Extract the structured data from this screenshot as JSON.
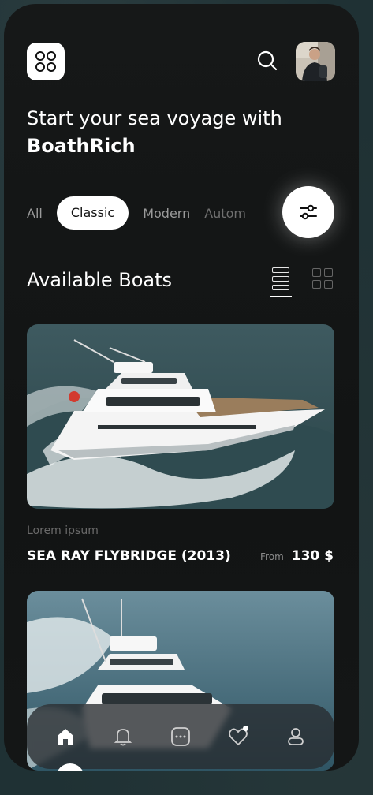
{
  "header": {
    "logo_icon": "app-grid-icon",
    "search_icon": "search-icon",
    "avatar": "user-avatar"
  },
  "hero": {
    "line1": "Start your sea voyage with",
    "brand": "BoathRich"
  },
  "categories": [
    "All",
    "Classic",
    "Modern",
    "Autom"
  ],
  "selected_category": "Classic",
  "filter_icon": "sliders-icon",
  "section": {
    "title": "Available Boats",
    "view_modes": [
      "list",
      "grid"
    ],
    "active_view": "list"
  },
  "boats": [
    {
      "subtitle": "Lorem ipsum",
      "name": "SEA RAY FLYBRIDGE (2013)",
      "price_prefix": "From",
      "price": "130 $"
    }
  ],
  "tabbar": {
    "items": [
      "home-icon",
      "bell-icon",
      "chat-icon",
      "heart-icon",
      "profile-icon"
    ],
    "active": "home-icon"
  },
  "colors": {
    "background": "#141616",
    "accent": "#ffffff",
    "muted_text": "#9a9a9a"
  }
}
